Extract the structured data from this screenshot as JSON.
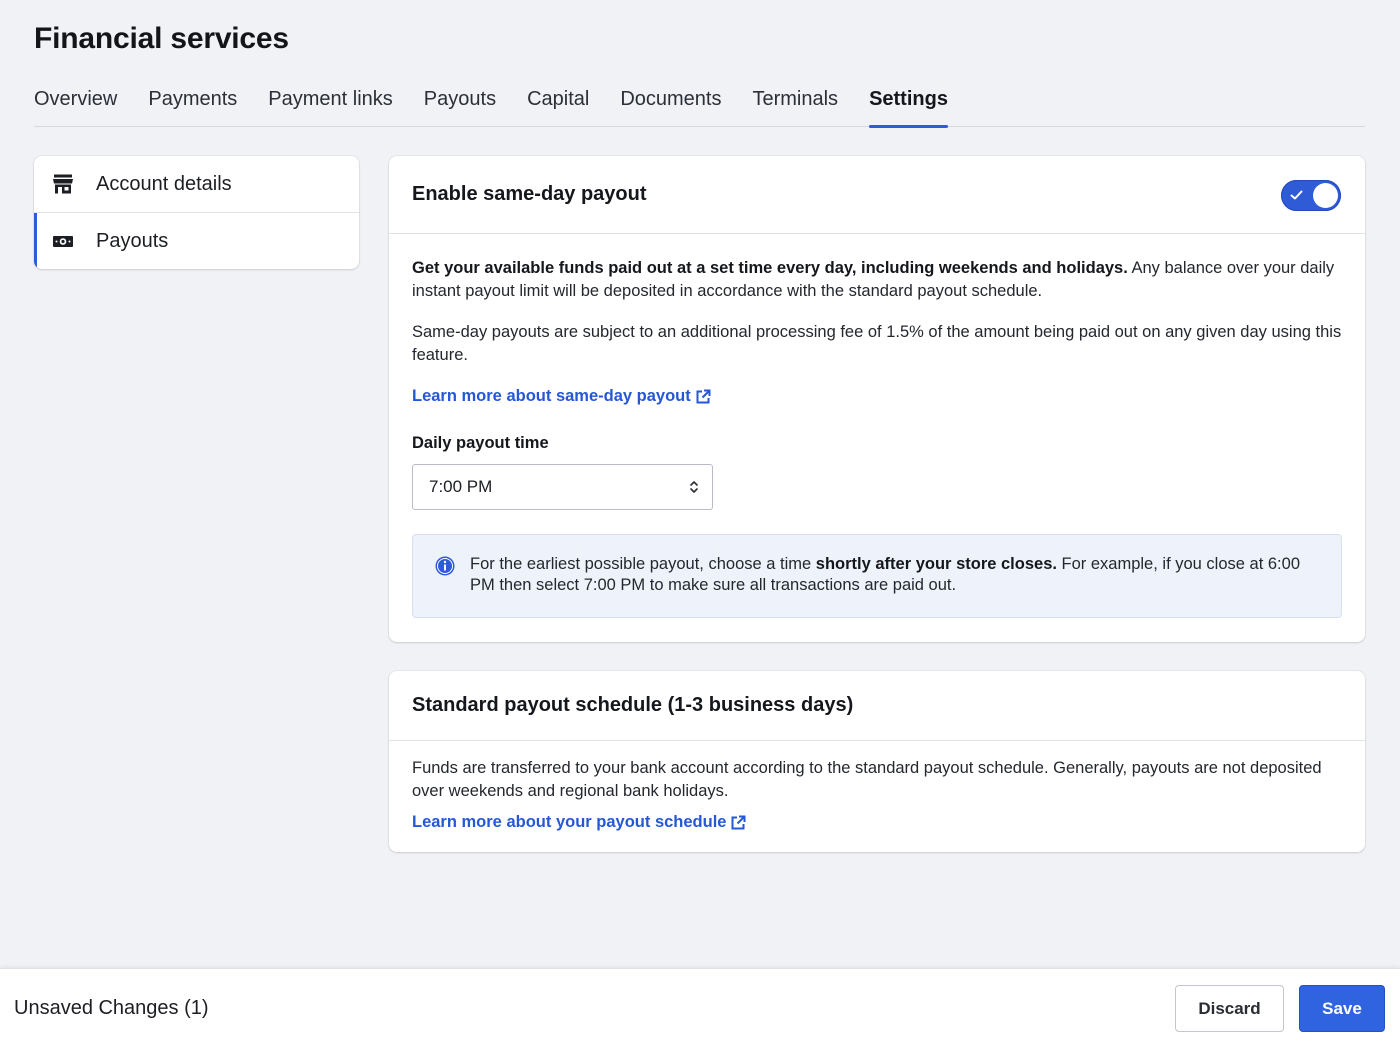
{
  "page": {
    "title": "Financial services"
  },
  "tabs": [
    {
      "label": "Overview"
    },
    {
      "label": "Payments"
    },
    {
      "label": "Payment links"
    },
    {
      "label": "Payouts"
    },
    {
      "label": "Capital"
    },
    {
      "label": "Documents"
    },
    {
      "label": "Terminals"
    },
    {
      "label": "Settings",
      "active": true
    }
  ],
  "sidebar": {
    "items": [
      {
        "label": "Account details",
        "icon": "storefront-icon"
      },
      {
        "label": "Payouts",
        "icon": "banknote-icon",
        "active": true
      }
    ]
  },
  "same_day": {
    "title": "Enable same-day payout",
    "toggle_on": true,
    "para1_bold": "Get your available funds paid out at a set time every day, including weekends and holidays.",
    "para1_rest": " Any balance over your daily instant payout limit will be deposited in accordance with the standard payout schedule.",
    "para2": "Same-day payouts are subject to an additional processing fee of 1.5% of the amount being paid out on any given day using this feature.",
    "learn_more": "Learn more about same-day payout",
    "field_label": "Daily payout time",
    "selected_time": "7:00 PM",
    "info_pre": "For the earliest possible payout, choose a time ",
    "info_bold": "shortly after your store closes.",
    "info_post": " For example, if you close at 6:00 PM then select 7:00 PM to make sure all transactions are paid out."
  },
  "standard": {
    "title": "Standard payout schedule (1-3 business days)",
    "body": "Funds are transferred to your bank account according to the standard payout schedule. Generally, payouts are not deposited over weekends and regional bank holidays.",
    "learn_more": "Learn more about your payout schedule"
  },
  "footer": {
    "unsaved": "Unsaved Changes (1)",
    "discard": "Discard",
    "save": "Save"
  },
  "colors": {
    "accent": "#2f5bd6",
    "link": "#2557d6",
    "info_bg": "#eef3fb"
  }
}
